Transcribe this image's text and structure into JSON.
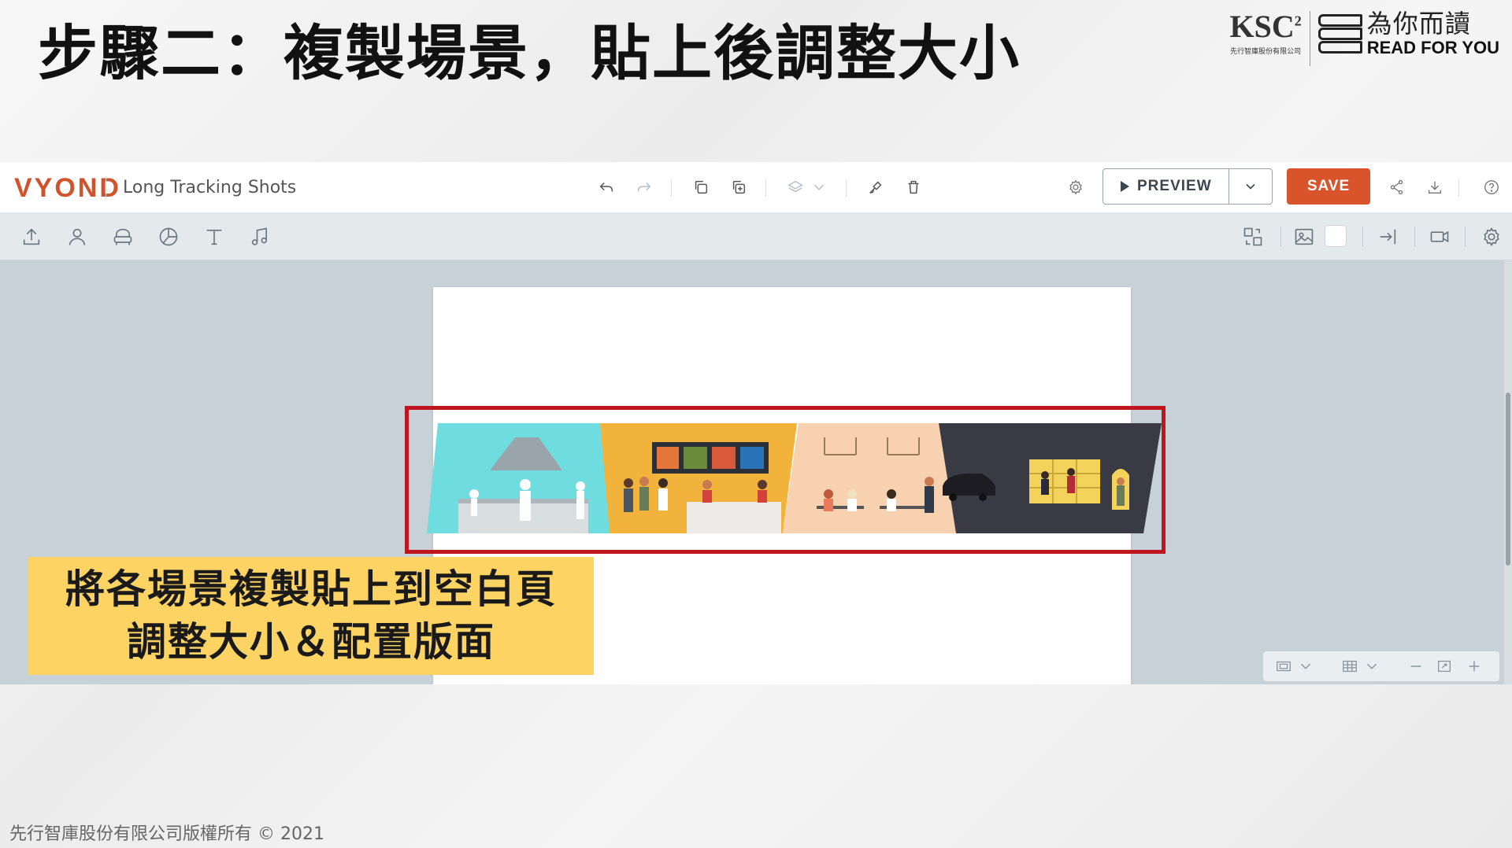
{
  "slide": {
    "title": "步驟二：複製場景，貼上後調整大小",
    "caption_line1": "將各場景複製貼上到空白頁",
    "caption_line2": "調整大小＆配置版面",
    "footer": "先行智庫股份有限公司版權所有 © 2021"
  },
  "logos": {
    "ksc_mark": "KSC",
    "ksc_sup": "2",
    "ksc_sub": "先行智庫股份有限公司",
    "rfy_cn": "為你而讀",
    "rfy_en": "READ FOR YOU"
  },
  "app": {
    "brand": "VYOND",
    "project_title": "Long Tracking Shots",
    "preview_label": "PREVIEW",
    "save_label": "SAVE"
  },
  "colors": {
    "accent": "#d9542b",
    "highlight": "#c0141f",
    "caption_bg": "#fdd463",
    "canvas_bg": "#c6d1d8",
    "scene_kitchen": "#6fdde0",
    "scene_counter": "#f2b33d",
    "scene_dining": "#f8d2b0",
    "scene_night": "#3a3a44"
  },
  "icons": {
    "topbar": [
      "undo-icon",
      "redo-icon",
      "copy-icon",
      "duplicate-icon",
      "layers-icon",
      "brush-icon",
      "trash-icon",
      "settings-icon",
      "share-icon",
      "download-icon",
      "help-icon"
    ],
    "toolbar": [
      "upload-icon",
      "character-icon",
      "props-icon",
      "chart-icon",
      "text-icon",
      "music-icon",
      "swap-icon",
      "image-icon",
      "enter-icon",
      "camera-icon",
      "gear-icon"
    ],
    "zoom": [
      "frame-icon",
      "grid-icon",
      "zoom-out-icon",
      "fit-icon",
      "zoom-in-icon"
    ]
  }
}
